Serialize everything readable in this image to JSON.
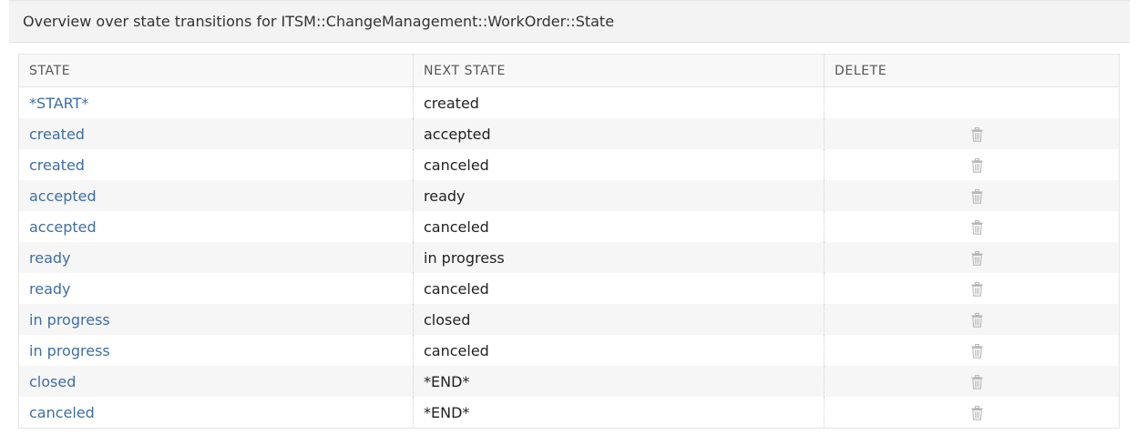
{
  "panel": {
    "title": "Overview over state transitions for ITSM::ChangeManagement::WorkOrder::State"
  },
  "table": {
    "headers": {
      "state": "STATE",
      "next_state": "NEXT STATE",
      "delete": "DELETE"
    },
    "rows": [
      {
        "state": "*START*",
        "next_state": "created",
        "deletable": false
      },
      {
        "state": "created",
        "next_state": "accepted",
        "deletable": true
      },
      {
        "state": "created",
        "next_state": "canceled",
        "deletable": true
      },
      {
        "state": "accepted",
        "next_state": "ready",
        "deletable": true
      },
      {
        "state": "accepted",
        "next_state": "canceled",
        "deletable": true
      },
      {
        "state": "ready",
        "next_state": "in progress",
        "deletable": true
      },
      {
        "state": "ready",
        "next_state": "canceled",
        "deletable": true
      },
      {
        "state": "in progress",
        "next_state": "closed",
        "deletable": true
      },
      {
        "state": "in progress",
        "next_state": "canceled",
        "deletable": true
      },
      {
        "state": "closed",
        "next_state": "*END*",
        "deletable": true
      },
      {
        "state": "canceled",
        "next_state": "*END*",
        "deletable": true
      }
    ]
  },
  "icons": {
    "delete": "trash-icon"
  },
  "colors": {
    "link": "#3d6ea5",
    "header_bg": "#f3f3f3",
    "icon": "#b8b8b8"
  }
}
